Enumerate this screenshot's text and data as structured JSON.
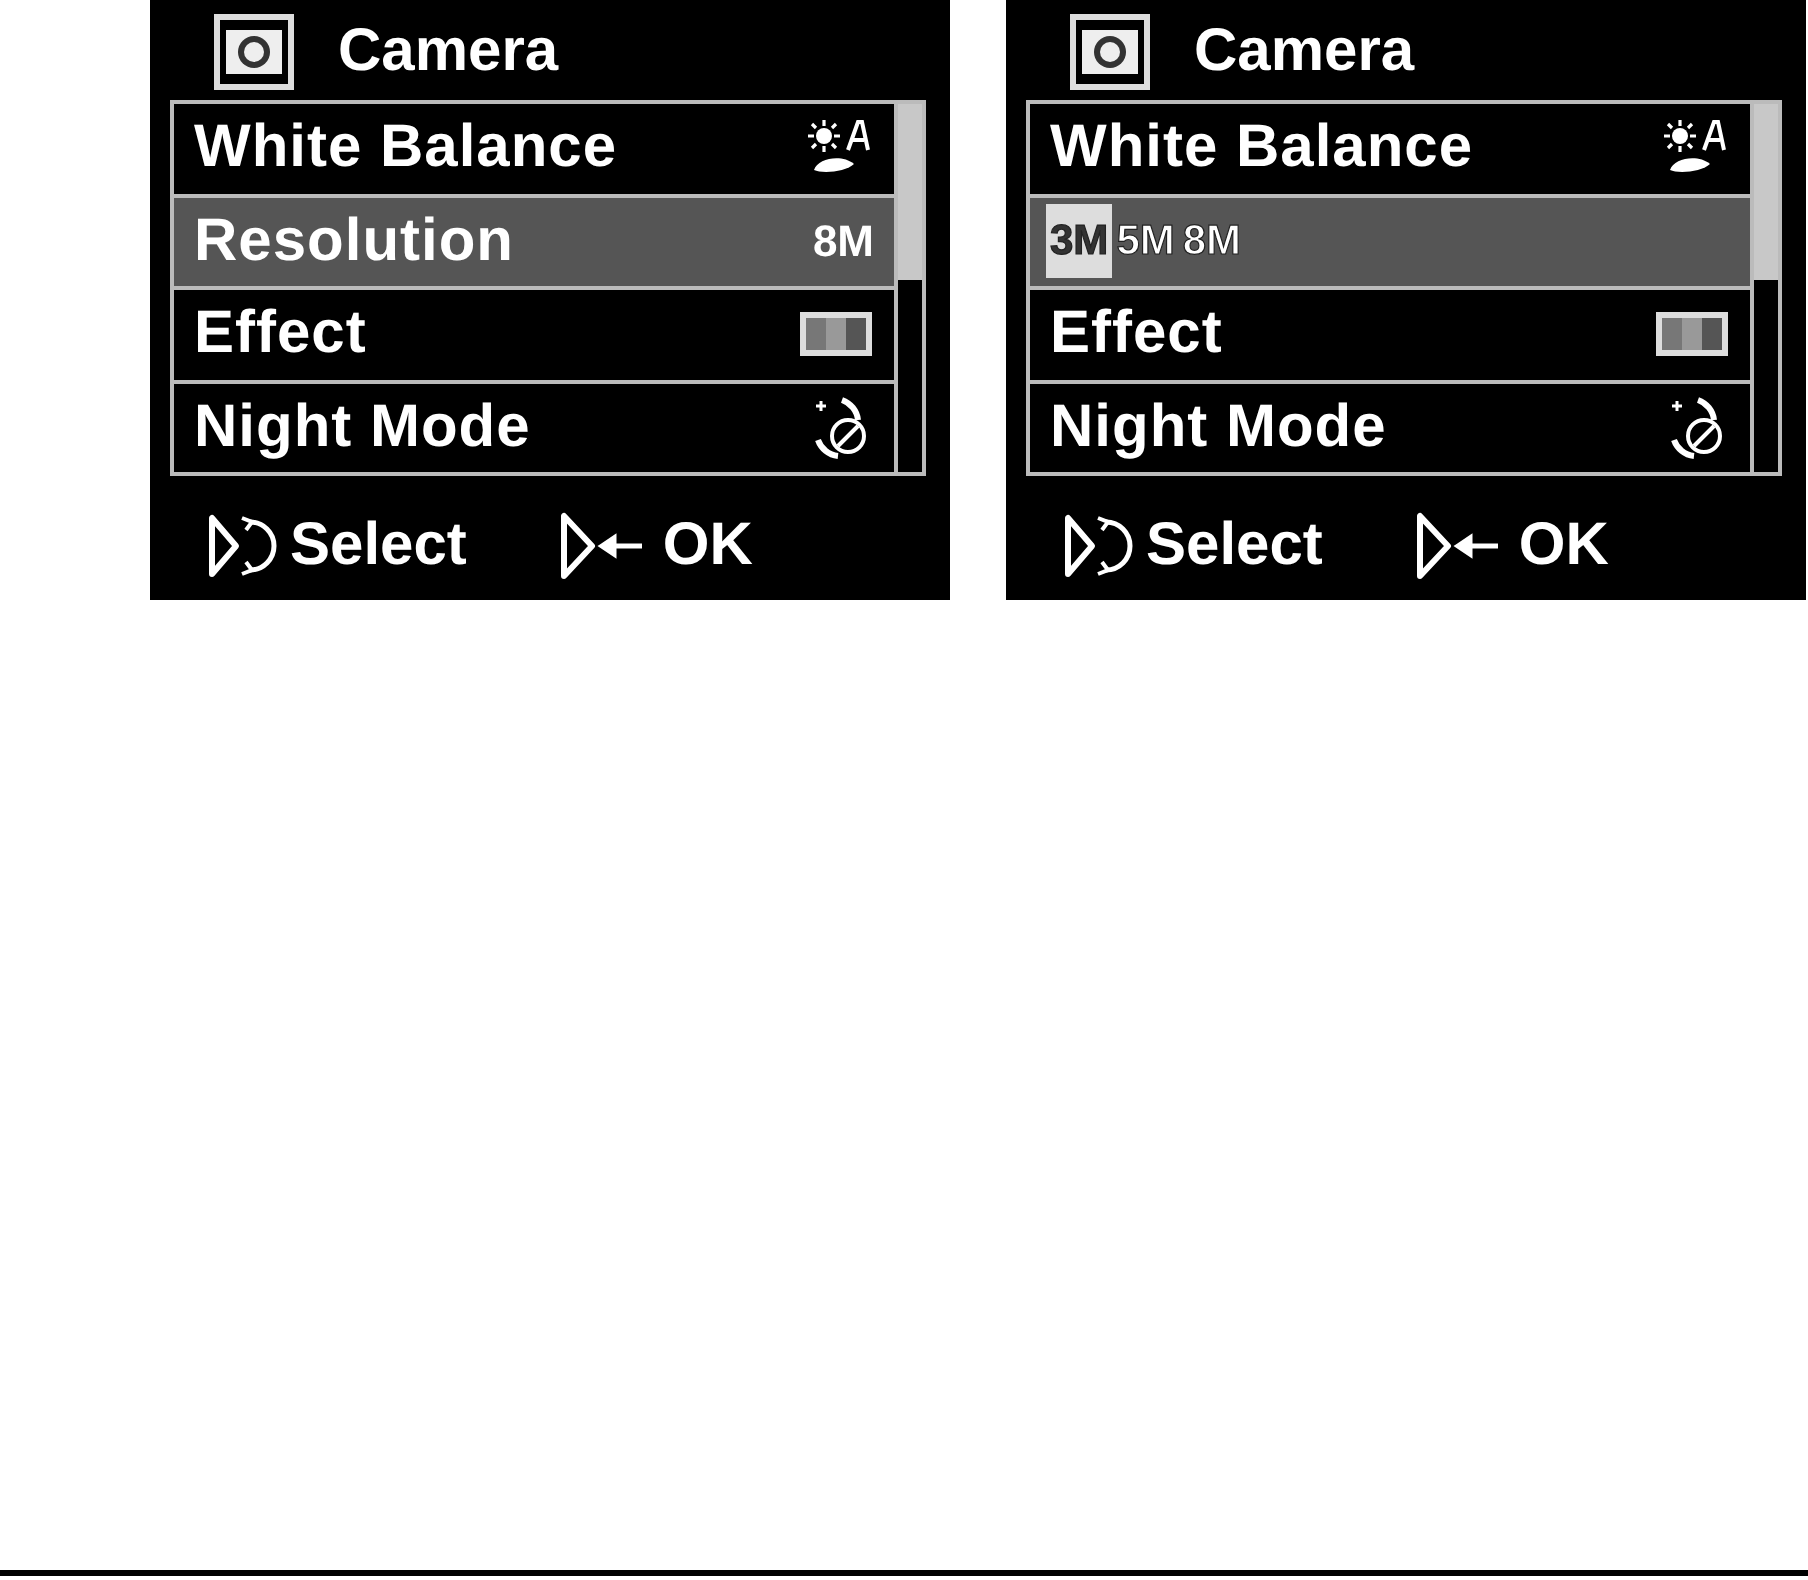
{
  "screens": [
    {
      "title": "Camera",
      "rows": [
        {
          "kind": "setting",
          "label": "White Balance",
          "selected": false
        },
        {
          "kind": "setting",
          "label": "Resolution",
          "value": "8M",
          "selected": true
        },
        {
          "kind": "setting",
          "label": "Effect",
          "selected": false
        },
        {
          "kind": "setting",
          "label": "Night Mode",
          "selected": false
        }
      ],
      "hints": [
        "Select",
        "OK"
      ]
    },
    {
      "title": "Camera",
      "rows": [
        {
          "kind": "setting",
          "label": "White Balance",
          "selected": false
        },
        {
          "kind": "options",
          "selected": true,
          "options": [
            {
              "label": "3M",
              "selected": true
            },
            {
              "label": "5M",
              "selected": false
            },
            {
              "label": "8M",
              "selected": false
            }
          ]
        },
        {
          "kind": "setting",
          "label": "Effect",
          "selected": false
        },
        {
          "kind": "setting",
          "label": "Night Mode",
          "selected": false
        }
      ],
      "hints": [
        "Select",
        "OK"
      ]
    }
  ]
}
